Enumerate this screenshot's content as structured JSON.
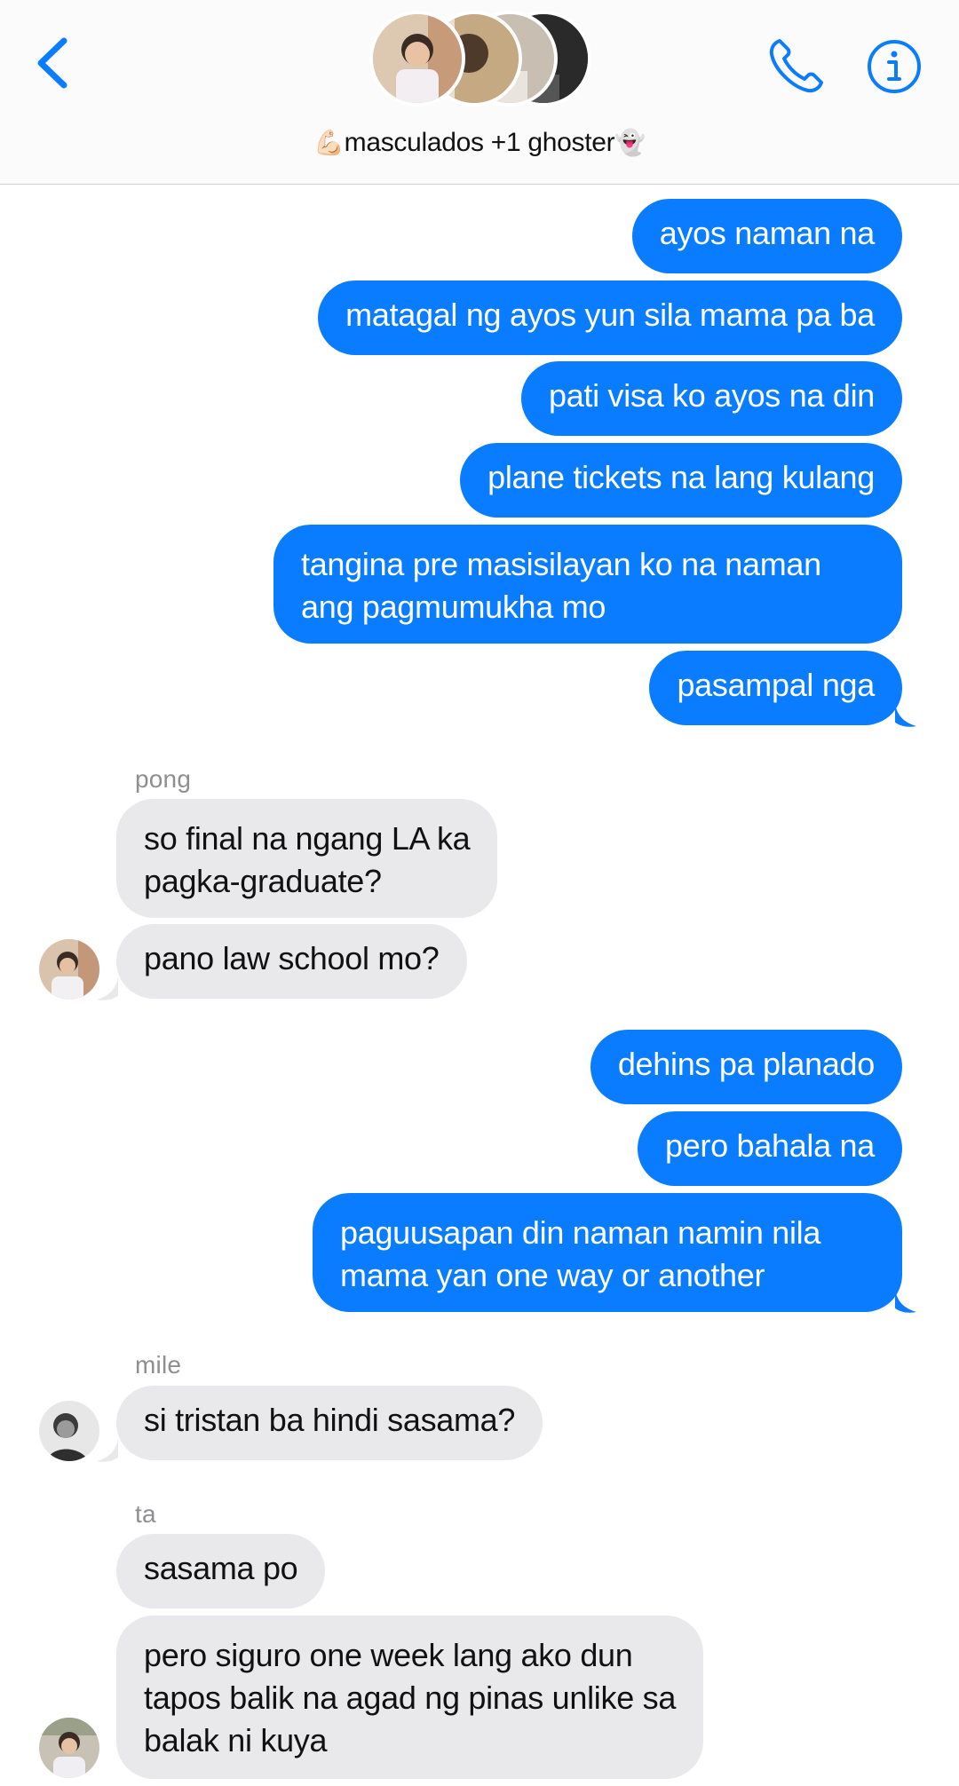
{
  "header": {
    "group_name": "masculados +1 ghoster",
    "emoji_left": "💪🏻",
    "emoji_right": "👻",
    "icons": {
      "back": "chevron-left-icon",
      "call": "phone-icon",
      "info": "info-icon"
    },
    "accent_color": "#0a7cff"
  },
  "messages": [
    {
      "from": "me",
      "text": "ayos naman na"
    },
    {
      "from": "me",
      "text": "matagal ng ayos yun sila mama pa ba"
    },
    {
      "from": "me",
      "text": "pati visa ko ayos na din"
    },
    {
      "from": "me",
      "text": "plane tickets na lang kulang"
    },
    {
      "from": "me",
      "lines": [
        "tangina pre masisilayan ko na naman",
        "ang pagmumukha mo"
      ]
    },
    {
      "from": "me",
      "text": "pasampal nga"
    },
    {
      "sender_label": "pong"
    },
    {
      "from": "pong",
      "lines": [
        "so final na ngang LA ka",
        "pagka-graduate?"
      ]
    },
    {
      "from": "pong",
      "text": "pano law school mo?"
    },
    {
      "from": "me",
      "text": "dehins pa planado"
    },
    {
      "from": "me",
      "text": "pero bahala na"
    },
    {
      "from": "me",
      "lines": [
        "paguusapan din naman namin nila",
        "mama yan one way or another"
      ]
    },
    {
      "sender_label": "mile"
    },
    {
      "from": "mile",
      "text": "si tristan ba hindi sasama?"
    },
    {
      "sender_label": "ta"
    },
    {
      "from": "ta",
      "text": "sasama po"
    },
    {
      "from": "ta",
      "lines": [
        "pero siguro one week lang ako dun",
        "tapos balik na agad ng pinas unlike sa",
        "balak ni kuya"
      ]
    }
  ],
  "colors": {
    "outgoing_bubble": "#0a7cff",
    "incoming_bubble": "#e9e9ec",
    "sender_label": "#8e8e93"
  }
}
